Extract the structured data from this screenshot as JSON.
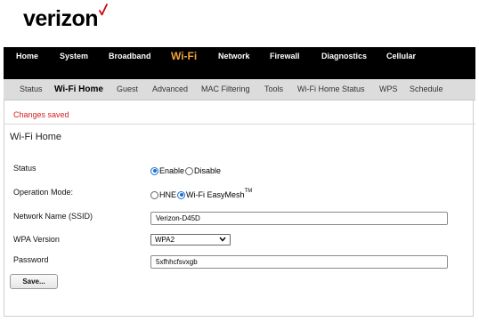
{
  "brand": {
    "name": "verizon",
    "accent": "#cd040b"
  },
  "top_nav": {
    "items": [
      {
        "label": "Home"
      },
      {
        "label": "System"
      },
      {
        "label": "Broadband"
      },
      {
        "label": "Wi-Fi"
      },
      {
        "label": "Network"
      },
      {
        "label": "Firewall"
      },
      {
        "label": "Diagnostics"
      },
      {
        "label": "Cellular"
      }
    ],
    "active": "Wi-Fi",
    "active_color": "#f2a33a"
  },
  "sub_nav": {
    "items": [
      {
        "label": "Status"
      },
      {
        "label": "Wi-Fi Home"
      },
      {
        "label": "Guest"
      },
      {
        "label": "Advanced"
      },
      {
        "label": "MAC Filtering"
      },
      {
        "label": "Tools"
      },
      {
        "label": "Wi-Fi Home Status"
      },
      {
        "label": "WPS"
      },
      {
        "label": "Schedule"
      }
    ],
    "active": "Wi-Fi Home"
  },
  "status_message": "Changes saved",
  "page_title": "Wi-Fi Home",
  "form": {
    "status": {
      "label": "Status",
      "options": [
        "Enable",
        "Disable"
      ],
      "selected": "Enable"
    },
    "operation_mode": {
      "label": "Operation Mode:",
      "options": [
        "HNE",
        "Wi-Fi EasyMesh"
      ],
      "trademark": "TM",
      "selected": "Wi-Fi EasyMesh"
    },
    "ssid": {
      "label": "Network Name (SSID)",
      "value": "Verizon-D45D"
    },
    "wpa": {
      "label": "WPA Version",
      "value": "WPA2"
    },
    "password": {
      "label": "Password",
      "value": "5xfhhcfsvxgb"
    },
    "save_label": "Save..."
  }
}
